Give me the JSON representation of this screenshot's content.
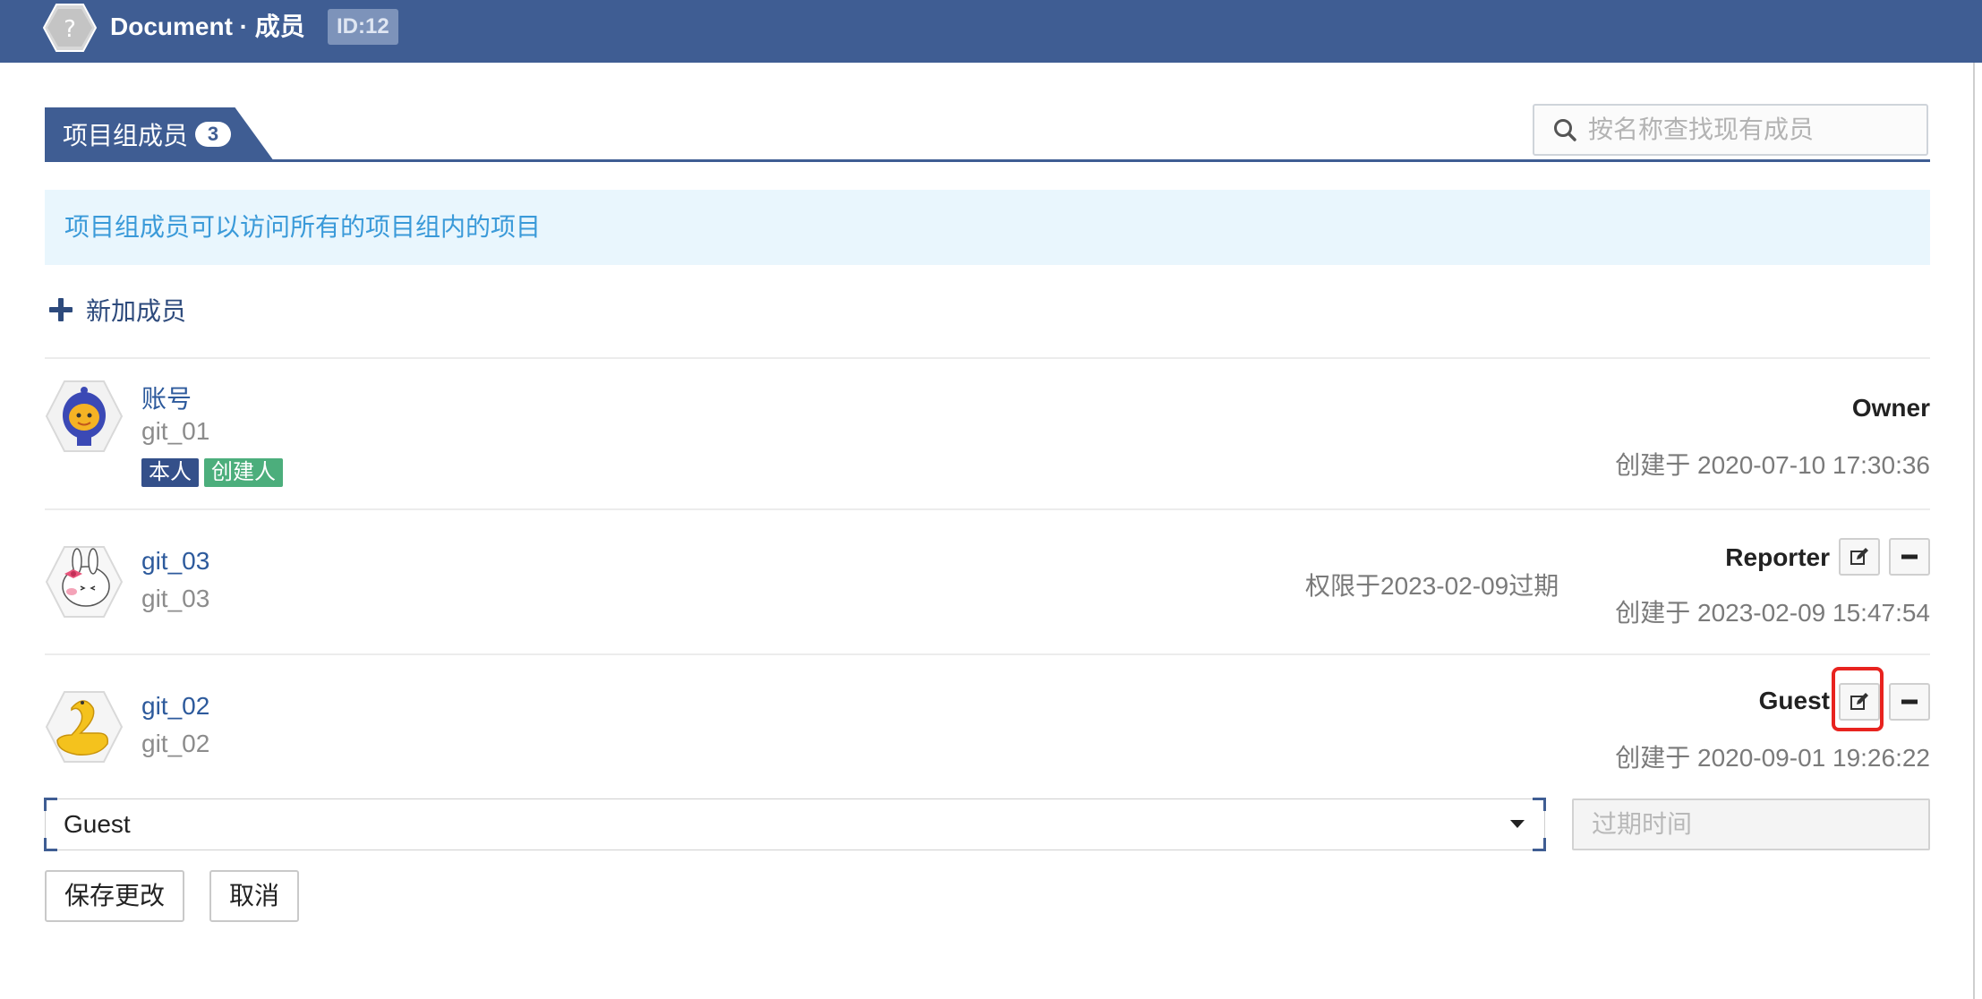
{
  "header": {
    "title": "Document · 成员",
    "id_badge": "ID:12"
  },
  "tab": {
    "label": "项目组成员",
    "count": "3"
  },
  "search": {
    "placeholder": "按名称查找现有成员"
  },
  "info_text": "项目组成员可以访问所有的项目组内的项目",
  "add_member_label": "新加成员",
  "members": [
    {
      "display_name": "账号",
      "username": "git_01",
      "tags": [
        "本人",
        "创建人"
      ],
      "role": "Owner",
      "created": "创建于 2020-07-10 17:30:36",
      "avatar_icon": "blue-hooded-mascot-avatar"
    },
    {
      "display_name": "git_03",
      "username": "git_03",
      "role": "Reporter",
      "expire_note": "权限于2023-02-09过期",
      "created": "创建于 2023-02-09 15:47:54",
      "avatar_icon": "bunny-with-bow-avatar"
    },
    {
      "display_name": "git_02",
      "username": "git_02",
      "role": "Guest",
      "created": "创建于 2020-09-01 19:26:22",
      "avatar_icon": "yellow-swan-avatar"
    }
  ],
  "edit_form": {
    "role_value": "Guest",
    "expire_placeholder": "过期时间",
    "save_label": "保存更改",
    "cancel_label": "取消"
  },
  "colors": {
    "header_bg": "#3f5d93",
    "info_bg": "#e9f6fd",
    "info_text": "#3a9ad9",
    "tag_self": "#34508a",
    "tag_creator": "#4cae7c",
    "highlight": "#e8231f"
  }
}
